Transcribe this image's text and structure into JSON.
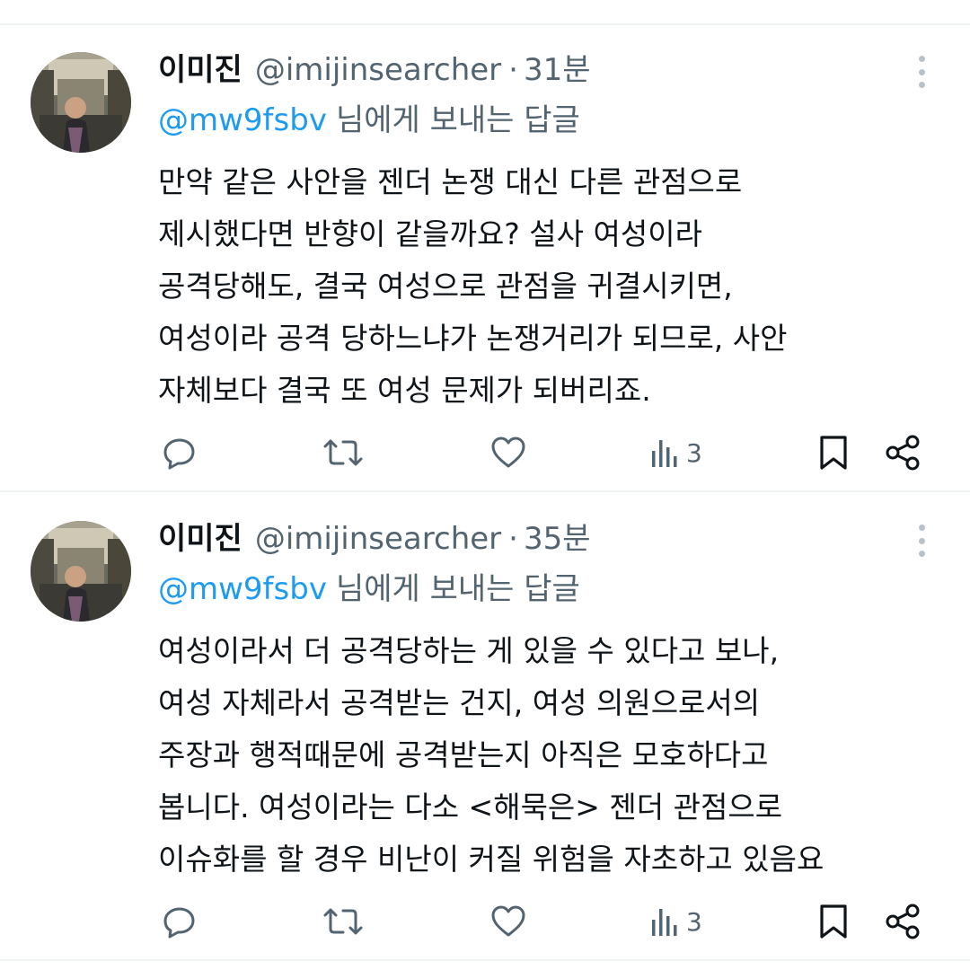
{
  "tweets": [
    {
      "author_name": "이미진",
      "author_handle": "@imijinsearcher",
      "separator": "·",
      "time": "31분",
      "reply_handle": "@mw9fsbv",
      "reply_suffix": "님에게 보내는 답글",
      "text_lines": [
        "만약 같은 사안을 젠더 논쟁 대신 다른 관점으로",
        "제시했다면 반향이 같을까요? 설사 여성이라",
        "공격당해도, 결국 여성으로 관점을 귀결시키면,",
        "여성이라 공격 당하느냐가 논쟁거리가 되므로, 사안",
        "자체보다 결국 또 여성 문제가 되버리죠."
      ],
      "views": "3"
    },
    {
      "author_name": "이미진",
      "author_handle": "@imijinsearcher",
      "separator": "·",
      "time": "35분",
      "reply_handle": "@mw9fsbv",
      "reply_suffix": "님에게 보내는 답글",
      "text_lines": [
        "여성이라서 더 공격당하는 게 있을 수 있다고 보나,",
        "여성 자체라서 공격받는 건지, 여성 의원으로서의",
        "주장과 행적때문에 공격받는지 아직은 모호하다고",
        "봅니다. 여성이라는 다소 <해묵은> 젠더 관점으로",
        "이슈화를 할 경우 비난이 커질 위험을 자초하고 있음요"
      ],
      "views": "3"
    }
  ],
  "icons": {
    "reply": "reply-icon",
    "retweet": "retweet-icon",
    "like": "like-icon",
    "views": "views-icon",
    "bookmark": "bookmark-icon",
    "share": "share-icon",
    "more": "more-icon"
  },
  "colors": {
    "link": "#1d9bf0",
    "secondary_text": "#536471",
    "primary_text": "#0f1419",
    "divider": "#eff3f4"
  }
}
